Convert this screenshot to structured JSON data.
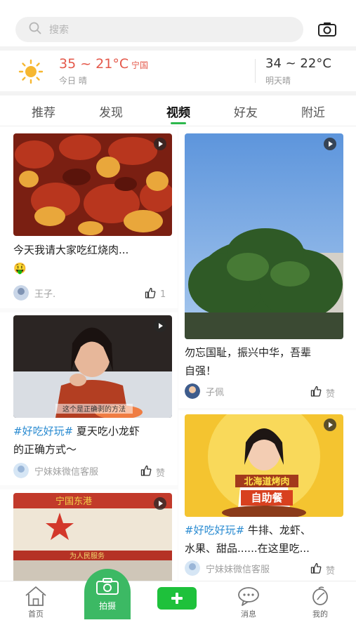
{
  "search": {
    "placeholder": "搜索"
  },
  "weather": {
    "today_temp": "35 ~ 21°C",
    "city": "宁国",
    "today_desc": "今日 晴",
    "tomorrow_temp": "34 ~ 22°C",
    "tomorrow_desc": "明天晴"
  },
  "tabs": [
    {
      "label": "推荐"
    },
    {
      "label": "发现"
    },
    {
      "label": "视频",
      "active": true
    },
    {
      "label": "好友"
    },
    {
      "label": "附近"
    }
  ],
  "feed": {
    "left": [
      {
        "title_line1": "今天我请大家吃红烧肉...",
        "title_emoji": "🤑",
        "author": "王子.",
        "likes": "1"
      },
      {
        "tag": "#好吃好玩#",
        "title_line1_rest": " 夏天吃小龙虾",
        "title_line2": "的正确方式～",
        "author": "宁妹妹微信客服",
        "likes": "赞"
      },
      {
        "sign_text": "宁国东港",
        "banner_text": "为人民服务"
      }
    ],
    "right": [
      {
        "title_line1": "勿忘国耻，振兴中华，吾辈",
        "title_line2": "自强！",
        "author": "子佩",
        "likes": "赞"
      },
      {
        "tag": "#好吃好玩#",
        "title_line1_rest": " 牛排、龙虾、",
        "title_line2": "水果、甜品......在这里吃...",
        "author": "宁妹妹微信客服",
        "likes": "赞",
        "poster_text_1": "北海道烤肉",
        "poster_text_2": "自助餐"
      }
    ],
    "caption_overlay": "这个是正确剥的方法"
  },
  "bottom_nav": {
    "home": "首页",
    "shoot": "拍摄",
    "messages": "消息",
    "mine": "我的"
  },
  "colors": {
    "accent": "#2db84d",
    "temp": "#e4584a",
    "tag": "#2a8bd1"
  }
}
